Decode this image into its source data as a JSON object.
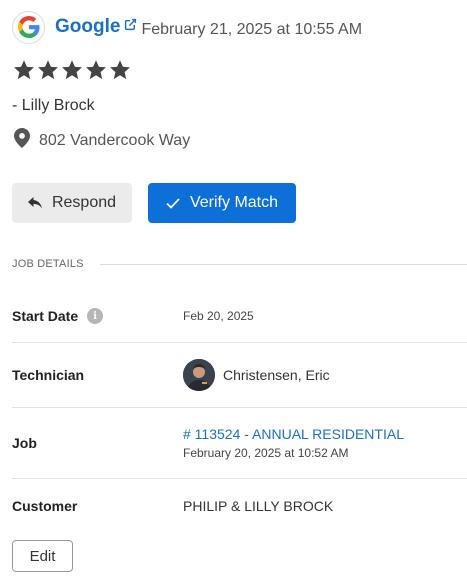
{
  "review": {
    "source_name": "Google",
    "date": "February 21, 2025 at 10:55 AM",
    "rating": 5,
    "reviewer": "- Lilly Brock",
    "address": "802 Vandercook Way"
  },
  "actions": {
    "respond_label": "Respond",
    "verify_label": "Verify Match"
  },
  "job_details": {
    "section_title": "JOB DETAILS",
    "start_date": {
      "label": "Start Date",
      "value": "Feb 20, 2025"
    },
    "technician": {
      "label": "Technician",
      "value": "Christensen, Eric"
    },
    "job": {
      "label": "Job",
      "link": "# 113524 - ANNUAL RESIDENTIAL",
      "date": "February 20, 2025 at 10:52 AM"
    },
    "customer": {
      "label": "Customer",
      "value": "PHILIP & LILLY BROCK"
    }
  },
  "edit_label": "Edit",
  "colors": {
    "accent": "#0d6fd8",
    "link": "#1a6fc9",
    "star": "#444444"
  },
  "icons": {
    "source_logo": "google-logo",
    "external_link": "external-link-icon",
    "star": "star-icon",
    "location": "map-pin-icon",
    "respond": "reply-icon",
    "verify": "check-icon",
    "info": "info-icon"
  }
}
